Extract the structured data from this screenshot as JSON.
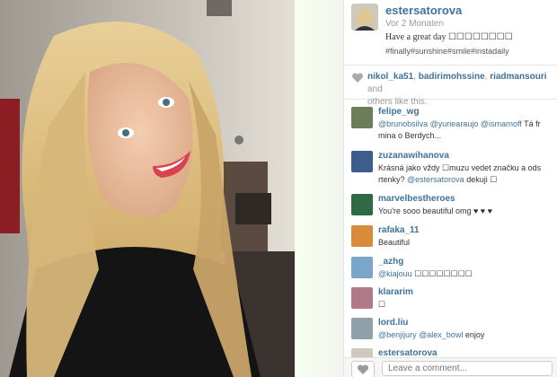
{
  "post": {
    "username": "estersatorova",
    "time_ago": "Vor 2 Monaten",
    "caption": "Have a great day ☐☐☐☐☐☐☐☐",
    "hashtags": "#finally#sunshine#smile#instadaily"
  },
  "likes": {
    "users": [
      "nikol_ka51",
      "badirimohssine",
      "riadmansouri"
    ],
    "suffix_and": "and",
    "suffix_rest": "others like this."
  },
  "comments": [
    {
      "user": "felipe_wg",
      "mentions": "@brunobsilva  @yuriearaujo  @ismarnoff",
      "text_after": " Tá fr",
      "line2": "mina o Berdych..."
    },
    {
      "user": "zuzanawihanova",
      "text": "Krásná jako vždy ☐muzu vedet značku a ods",
      "line2_mention": "@estersatorova",
      "line2_text": " dekuji ☐",
      "line2_pre": "rtenky? "
    },
    {
      "user": "marvelbestheroes",
      "text": "You're sooo beautiful omg ♥ ♥ ♥"
    },
    {
      "user": "rafaka_11",
      "text": "Beautiful"
    },
    {
      "user": "_azhg",
      "mention": "@kiajouu",
      "text_after": " ☐☐☐☐☐☐☐☐"
    },
    {
      "user": "klararim",
      "text": "☐"
    },
    {
      "user": "lord.liu",
      "mention": "@benjijury @alex_bowl",
      "text_after": " enjoy"
    },
    {
      "user": "estersatorova",
      "text": ""
    }
  ],
  "comment_input": {
    "placeholder": "Leave a comment..."
  },
  "colors": {
    "link": "#3f729b",
    "accent_green": "#f2fbe9"
  },
  "icons": [
    "heart-icon",
    "avatar"
  ]
}
